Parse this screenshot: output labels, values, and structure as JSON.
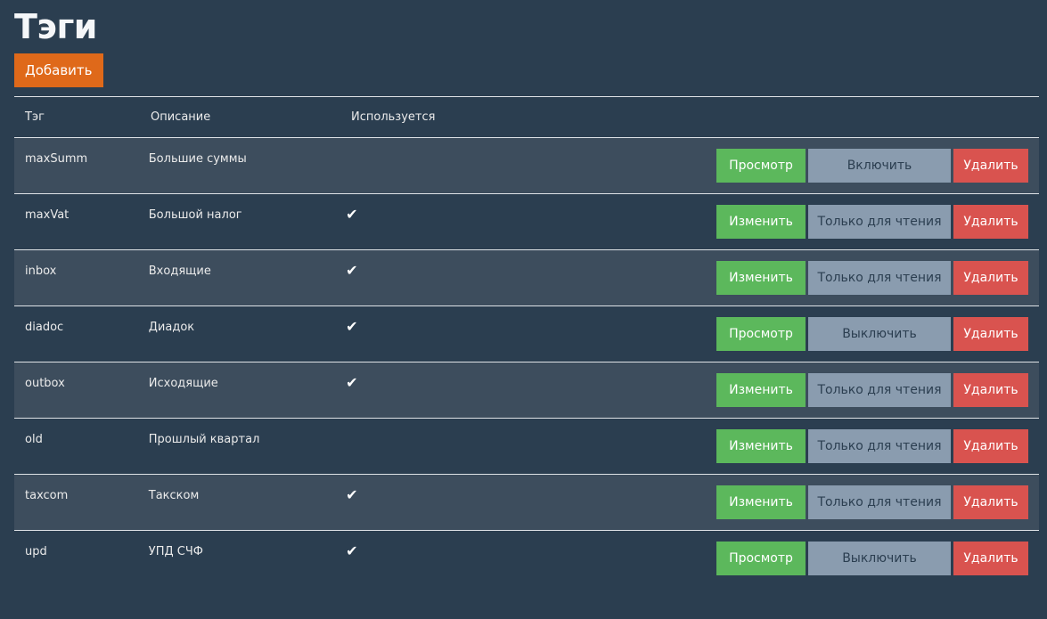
{
  "page": {
    "title": "Тэги",
    "add_label": "Добавить"
  },
  "table": {
    "headers": {
      "tag": "Тэг",
      "description": "Описание",
      "used": "Используется"
    },
    "rows": [
      {
        "tag": "maxSumm",
        "description": "Большие суммы",
        "used": "",
        "primary": "Просмотр",
        "secondary": "Включить",
        "delete": "Удалить"
      },
      {
        "tag": "maxVat",
        "description": "Большой налог",
        "used": "✔",
        "primary": "Изменить",
        "secondary": "Только для чтения",
        "delete": "Удалить"
      },
      {
        "tag": "inbox",
        "description": "Входящие",
        "used": "✔",
        "primary": "Изменить",
        "secondary": "Только для чтения",
        "delete": "Удалить"
      },
      {
        "tag": "diadoc",
        "description": "Диадок",
        "used": "✔",
        "primary": "Просмотр",
        "secondary": "Выключить",
        "delete": "Удалить"
      },
      {
        "tag": "outbox",
        "description": "Исходящие",
        "used": "✔",
        "primary": "Изменить",
        "secondary": "Только для чтения",
        "delete": "Удалить"
      },
      {
        "tag": "old",
        "description": "Прошлый квартал",
        "used": "",
        "primary": "Изменить",
        "secondary": "Только для чтения",
        "delete": "Удалить"
      },
      {
        "tag": "taxcom",
        "description": "Такском",
        "used": "✔",
        "primary": "Изменить",
        "secondary": "Только для чтения",
        "delete": "Удалить"
      },
      {
        "tag": "upd",
        "description": "УПД СЧФ",
        "used": "✔",
        "primary": "Просмотр",
        "secondary": "Выключить",
        "delete": "Удалить"
      }
    ]
  },
  "colors": {
    "background": "#2b3e50",
    "stripe": "#3d4d5d",
    "accent": "#df691a",
    "success": "#5cb85c",
    "neutral": "#8a9caf",
    "danger": "#d9534f"
  },
  "icons": {
    "used_marker": "check-icon"
  }
}
